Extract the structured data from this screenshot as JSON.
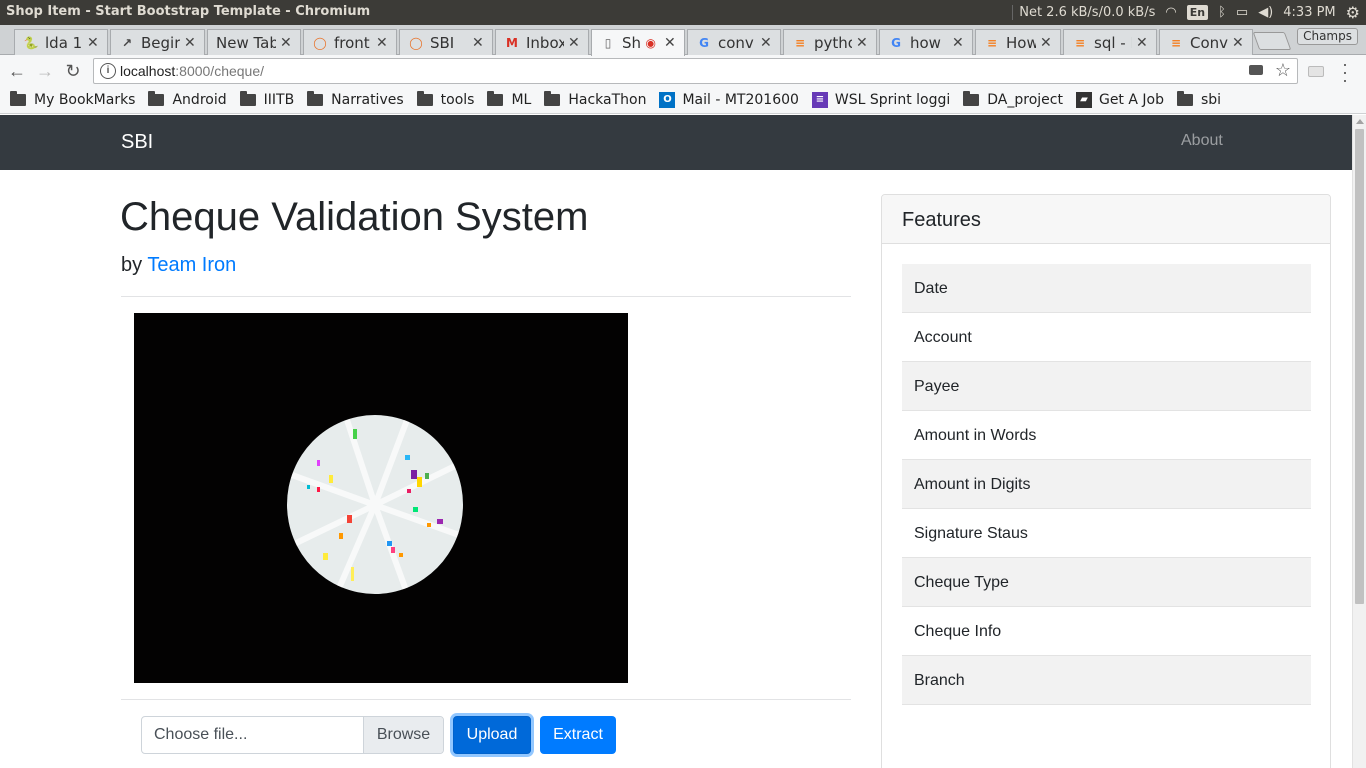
{
  "os": {
    "window_title": "Shop Item - Start Bootstrap Template - Chromium",
    "net": "Net 2.6 kB/s/0.0 kB/s",
    "lang": "En",
    "time": "4:33 PM"
  },
  "tabs": [
    {
      "label": "lda 1.",
      "icon": "python-icon"
    },
    {
      "label": "Begir",
      "icon": "chart-icon"
    },
    {
      "label": "New Tab",
      "icon": ""
    },
    {
      "label": "front",
      "icon": "ring-icon"
    },
    {
      "label": "SBI",
      "icon": "ring-icon"
    },
    {
      "label": "Inbox",
      "icon": "gmail-icon"
    },
    {
      "label": "Sh",
      "icon": "page-icon",
      "active": true
    },
    {
      "label": "conv",
      "icon": "google-icon"
    },
    {
      "label": "pytho",
      "icon": "stackoverflow-icon"
    },
    {
      "label": "how",
      "icon": "google-icon"
    },
    {
      "label": "How",
      "icon": "stackoverflow-icon"
    },
    {
      "label": "sql - I",
      "icon": "stackoverflow-icon"
    },
    {
      "label": "Conv",
      "icon": "stackoverflow-icon"
    }
  ],
  "profile": "Champs",
  "omnibox": {
    "host": "localhost",
    "path": ":8000/cheque/"
  },
  "bookmarks": [
    {
      "label": "My BookMarks",
      "type": "folder"
    },
    {
      "label": "Android",
      "type": "folder"
    },
    {
      "label": "IIITB",
      "type": "folder"
    },
    {
      "label": "Narratives",
      "type": "folder"
    },
    {
      "label": "tools",
      "type": "folder"
    },
    {
      "label": "ML",
      "type": "folder"
    },
    {
      "label": "HackaThon",
      "type": "folder"
    },
    {
      "label": "Mail - MT201600",
      "type": "outlook"
    },
    {
      "label": "WSL Sprint loggi",
      "type": "form"
    },
    {
      "label": "DA_project",
      "type": "folder"
    },
    {
      "label": "Get A Job",
      "type": "job"
    },
    {
      "label": "sbi",
      "type": "folder"
    }
  ],
  "navbar": {
    "brand": "SBI",
    "about": "About"
  },
  "main": {
    "title": "Cheque Validation System",
    "by": "by",
    "author": "Team Iron"
  },
  "upload": {
    "placeholder": "Choose file...",
    "browse": "Browse",
    "upload": "Upload",
    "extract": "Extract"
  },
  "features": {
    "title": "Features",
    "items": [
      "Date",
      "Account",
      "Payee",
      "Amount in Words",
      "Amount in Digits",
      "Signature Staus",
      "Cheque Type",
      "Cheque Info",
      "Branch"
    ]
  },
  "colors": {
    "navbar": "#343a40",
    "primary": "#007bff"
  }
}
